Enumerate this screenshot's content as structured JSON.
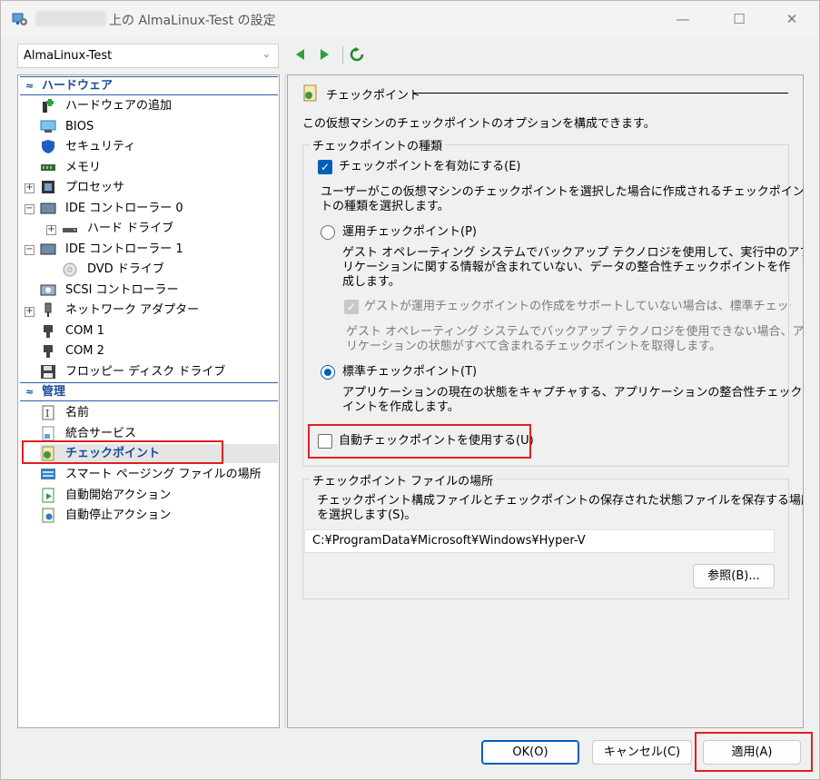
{
  "window": {
    "title": "上の AlmaLinux-Test の設定",
    "minimize_glyph": "—",
    "maximize_glyph": "☐",
    "close_glyph": "✕"
  },
  "vm_selector": {
    "value": "AlmaLinux-Test",
    "chevron": "⌄"
  },
  "navigation": {
    "icons": [
      "back-arrow-icon",
      "forward-arrow-icon",
      "refresh-icon"
    ]
  },
  "tree": {
    "hardware_header": "ハードウェア",
    "management_header": "管理",
    "collapse_glyph": "≈",
    "items": [
      {
        "label": "ハードウェアの追加",
        "icon": "add-hardware-icon"
      },
      {
        "label": "BIOS",
        "icon": "bios-icon"
      },
      {
        "label": "セキュリティ",
        "icon": "security-shield-icon"
      },
      {
        "label": "メモリ",
        "icon": "memory-icon"
      },
      {
        "label": "プロセッサ",
        "icon": "processor-icon",
        "expander": "+"
      },
      {
        "label": "IDE コントローラー 0",
        "icon": "ide-controller-icon",
        "expander": "−"
      },
      {
        "label": "ハード ドライブ",
        "icon": "hard-drive-icon",
        "expander": "+"
      },
      {
        "label": "IDE コントローラー 1",
        "icon": "ide-controller-icon",
        "expander": "−"
      },
      {
        "label": "DVD ドライブ",
        "icon": "dvd-drive-icon"
      },
      {
        "label": "SCSI コントローラー",
        "icon": "scsi-controller-icon"
      },
      {
        "label": "ネットワーク アダプター",
        "icon": "network-adapter-icon",
        "expander": "+"
      },
      {
        "label": "COM 1",
        "icon": "com-port-icon"
      },
      {
        "label": "COM 2",
        "icon": "com-port-icon"
      },
      {
        "label": "フロッピー ディスク ドライブ",
        "icon": "floppy-disk-icon"
      },
      {
        "label": "名前",
        "icon": "name-icon"
      },
      {
        "label": "統合サービス",
        "icon": "integration-services-icon"
      },
      {
        "label": "チェックポイント",
        "icon": "checkpoint-icon",
        "selected": true
      },
      {
        "label": "スマート ページング ファイルの場所",
        "icon": "smart-paging-icon"
      },
      {
        "label": "自動開始アクション",
        "icon": "auto-start-icon"
      },
      {
        "label": "自動停止アクション",
        "icon": "auto-stop-icon"
      }
    ]
  },
  "panel": {
    "section_title": "チェックポイント",
    "description": "この仮想マシンのチェックポイントのオプションを構成できます。",
    "type_group": {
      "label": "チェックポイントの種類",
      "enable_checkbox": {
        "label": "チェックポイントを有効にする(E)",
        "checked": true
      },
      "intro_line1": "ユーザーがこの仮想マシンのチェックポイントを選択した場合に作成されるチェックポイン",
      "intro_line2": "トの種類を選択します。",
      "production": {
        "label": "運用チェックポイント(P)",
        "selected": false,
        "desc_line1": "ゲスト オペレーティング システムでバックアップ テクノロジを使用して、実行中のアプ",
        "desc_line2": "リケーションに関する情報が含まれていない、データの整合性チェックポイントを作",
        "desc_line3": "成します。"
      },
      "fallback_checkbox": {
        "label": "ゲストが運用チェックポイントの作成をサポートしていない場合は、標準チェックポイ",
        "checked": true,
        "enabled": false
      },
      "fallback_desc_line1": "ゲスト オペレーティング システムでバックアップ テクノロジを使用できない場合、アプ",
      "fallback_desc_line2": "リケーションの状態がすべて含まれるチェックポイントを取得します。",
      "standard": {
        "label": "標準チェックポイント(T)",
        "selected": true,
        "desc_line1": "アプリケーションの現在の状態をキャプチャする、アプリケーションの整合性チェックポ",
        "desc_line2": "イントを作成します。"
      },
      "auto_checkbox": {
        "label": "自動チェックポイントを使用する(U)",
        "checked": false
      }
    },
    "location_group": {
      "label": "チェックポイント ファイルの場所",
      "desc_line1": "チェックポイント構成ファイルとチェックポイントの保存された状態ファイルを保存する場所",
      "desc_line2": "を選択します(S)。",
      "path": "C:¥ProgramData¥Microsoft¥Windows¥Hyper-V",
      "browse_button": "参照(B)..."
    }
  },
  "footer": {
    "ok_button": "OK(O)",
    "cancel_button": "キャンセル(C)",
    "apply_button": "適用(A)"
  },
  "colors": {
    "accent": "#005fb8",
    "category_text": "#1a4b99",
    "highlight_box": "#e02020",
    "window_bg": "#f0f0f0"
  }
}
